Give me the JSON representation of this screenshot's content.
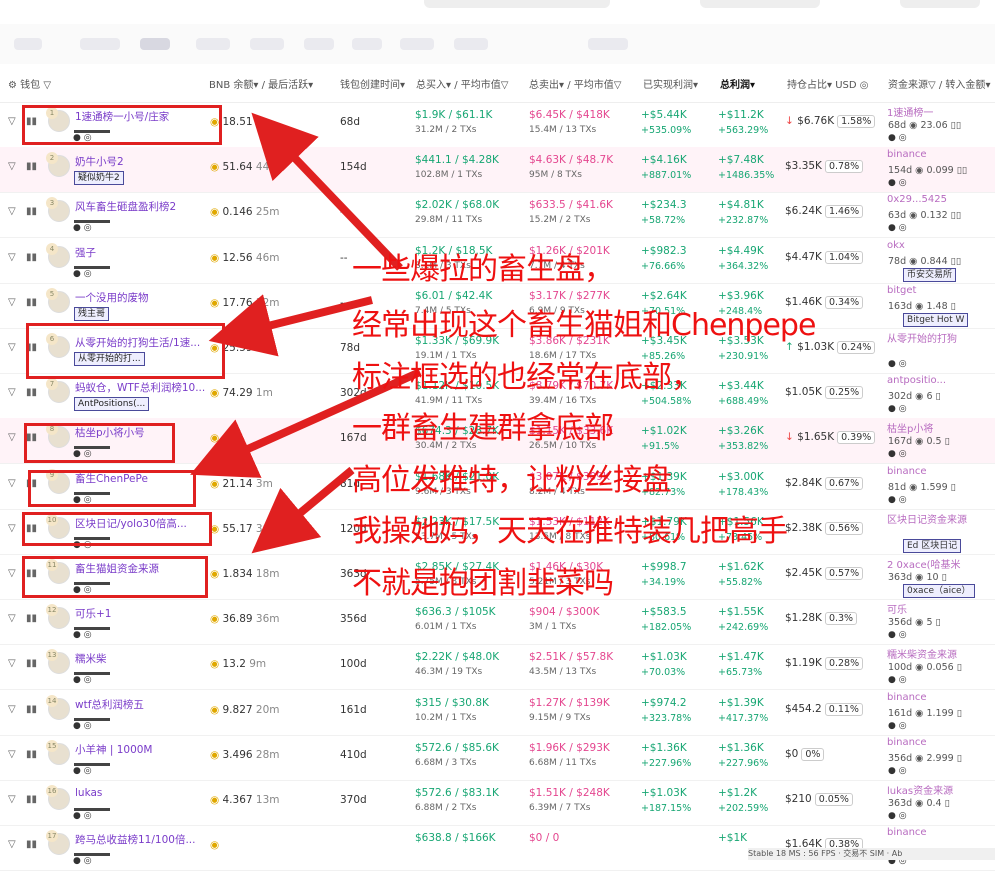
{
  "header": {
    "wallet": "钱包",
    "bnb_balance": "BNB 余额",
    "last_active": "/ 最后活跃",
    "created": "钱包创建时间",
    "total_buy": "总买入",
    "avg_buy": "/ 平均市值",
    "total_sell": "总卖出",
    "avg_sell": "/ 平均市值",
    "realized": "已实现利润",
    "total_profit": "总利润",
    "holding": "持仓占比",
    "usd": "USD",
    "fund_source": "资金来源",
    "transfer_in": "/ 转入金额"
  },
  "rows": [
    {
      "rank": "1",
      "name": "1速通榜一小号/庄家",
      "tag": "",
      "bnb": "18.51",
      "active": "7s",
      "age": "68d",
      "buy": "$1.9K / $61.1K",
      "buy_sub": "31.2M / 2 TXs",
      "sell": "$6.45K / $418K",
      "sell_sub": "15.4M / 13 TXs",
      "realized": "+$5.44K",
      "realized_pct": "+535.09%",
      "profit": "+$11.2K",
      "profit_pct": "+563.29%",
      "hold_arrow": "↓",
      "hold": "$6.76K",
      "hold_pct": "1.58%",
      "src": "1速通榜一",
      "src_sub": "68d ◉ 23.06 ▯▯",
      "src_box": "",
      "pink": false
    },
    {
      "rank": "2",
      "name": "奶牛小号2",
      "tag": "疑似奶牛2",
      "bnb": "51.64",
      "active": "44s",
      "age": "154d",
      "buy": "$441.1 / $4.28K",
      "buy_sub": "102.8M / 1 TXs",
      "sell": "$4.63K / $48.7K",
      "sell_sub": "95M / 8 TXs",
      "realized": "+$4.16K",
      "realized_pct": "+887.01%",
      "profit": "+$7.48K",
      "profit_pct": "+1486.35%",
      "hold_arrow": "",
      "hold": "$3.35K",
      "hold_pct": "0.78%",
      "src": "binance",
      "src_sub": "154d ◉ 0.099 ▯▯",
      "src_box": "",
      "pink": true
    },
    {
      "rank": "3",
      "name": "风车畜生砸盘盈利榜2",
      "tag": "",
      "bnb": "0.146",
      "active": "25m",
      "age": "--",
      "buy": "$2.02K / $68.0K",
      "buy_sub": "29.8M / 11 TXs",
      "sell": "$633.5 / $41.6K",
      "sell_sub": "15.2M / 2 TXs",
      "realized": "+$234.3",
      "realized_pct": "+58.72%",
      "profit": "+$4.81K",
      "profit_pct": "+232.87%",
      "hold_arrow": "",
      "hold": "$6.24K",
      "hold_pct": "1.46%",
      "src": "0x29...5425",
      "src_sub": "63d ◉ 0.132 ▯▯",
      "src_box": "",
      "pink": false
    },
    {
      "rank": "4",
      "name": "强子",
      "tag": "",
      "bnb": "12.56",
      "active": "46m",
      "age": "--",
      "buy": "$1.2K / $18.5K",
      "buy_sub": "8.1M / 3 TXs",
      "sell": "$1.26K / $201K",
      "sell_sub": "7.7M / 4 TXs",
      "realized": "+$982.3",
      "realized_pct": "+76.66%",
      "profit": "+$4.49K",
      "profit_pct": "+364.32%",
      "hold_arrow": "",
      "hold": "$4.47K",
      "hold_pct": "1.04%",
      "src": "okx",
      "src_sub": "78d ◉ 0.844 ▯▯",
      "src_box": "币安交易所",
      "pink": false
    },
    {
      "rank": "5",
      "name": "一个没用的废物",
      "tag": "残主哥",
      "bnb": "17.76",
      "active": "32m",
      "age": "--",
      "buy": "$6.01 / $42.4K",
      "buy_sub": "7.4M / 5 TXs",
      "sell": "$3.17K / $277K",
      "sell_sub": "6.9M / 9 TXs",
      "realized": "+$2.64K",
      "realized_pct": "+70.51%",
      "profit": "+$3.96K",
      "profit_pct": "+248.4%",
      "hold_arrow": "",
      "hold": "$1.46K",
      "hold_pct": "0.34%",
      "src": "bitget",
      "src_sub": "163d ◉ 1.48 ▯",
      "src_box": "Bitget Hot W",
      "pink": false
    },
    {
      "rank": "6",
      "name": "从零开始的打狗生活/1速...",
      "tag": "从零开始的打...",
      "bnb": "25.59",
      "active": "3m",
      "age": "78d",
      "buy": "$1.33K / $69.9K",
      "buy_sub": "19.1M / 1 TXs",
      "sell": "$3.86K / $231K",
      "sell_sub": "18.6M / 17 TXs",
      "realized": "+$3.45K",
      "realized_pct": "+85.26%",
      "profit": "+$3.53K",
      "profit_pct": "+230.91%",
      "hold_arrow": "↑",
      "hold": "$1.03K",
      "hold_pct": "0.24%",
      "src": "从零开始的打狗",
      "src_sub": "",
      "src_box": "",
      "pink": false
    },
    {
      "rank": "7",
      "name": "蚂蚁仓，WTF总利润榜10...",
      "tag": "AntPositions(...",
      "bnb": "74.29",
      "active": "1m",
      "age": "302d",
      "buy": "$1.12K / $10.5K",
      "buy_sub": "41.9M / 11 TXs",
      "sell": "$8.79K / $70.7K",
      "sell_sub": "39.4M / 16 TXs",
      "realized": "+$2.33K",
      "realized_pct": "+504.58%",
      "profit": "+$3.44K",
      "profit_pct": "+688.49%",
      "hold_arrow": "",
      "hold": "$1.05K",
      "hold_pct": "0.25%",
      "src": "antpositio...",
      "src_sub": "302d ◉ 6 ▯",
      "src_box": "",
      "pink": false
    },
    {
      "rank": "8",
      "name": "枯坐p小将小号",
      "tag": "",
      "bnb": "0.0",
      "active": "",
      "age": "167d",
      "buy": "$674.3 / $28.7K",
      "buy_sub": "30.4M / 2 TXs",
      "sell": "$1.15K / $33.6K",
      "sell_sub": "26.5M / 10 TXs",
      "realized": "+$1.02K",
      "realized_pct": "+91.5%",
      "profit": "+$3.26K",
      "profit_pct": "+353.82%",
      "hold_arrow": "↓",
      "hold": "$1.65K",
      "hold_pct": "0.39%",
      "src": "枯坐p小将",
      "src_sub": "167d ◉ 0.5 ▯",
      "src_box": "",
      "pink": true
    },
    {
      "rank": "9",
      "name": "畜生ChenPePe",
      "tag": "",
      "bnb": "21.14",
      "active": "3m",
      "age": "81d",
      "buy": "$1.68K / $21.0K",
      "buy_sub": "9.6M / 3 TXs",
      "sell": "$3.07K / $309K",
      "sell_sub": "8.2M / 4 TXs",
      "realized": "+$1.39K",
      "realized_pct": "+82.73%",
      "profit": "+$3.00K",
      "profit_pct": "+178.43%",
      "hold_arrow": "",
      "hold": "$2.84K",
      "hold_pct": "0.67%",
      "src": "binance",
      "src_sub": "81d ◉ 1.599 ▯",
      "src_box": "",
      "pink": false
    },
    {
      "rank": "10",
      "name": "区块日记/yolo30倍高...",
      "tag": "",
      "bnb": "55.17",
      "active": "30m",
      "age": "120d",
      "buy": "$2.23K / $17.5K",
      "buy_sub": "13.7M / 5 TXs",
      "sell": "$1.53K / $112K",
      "sell_sub": "13.5M / 8 TXs",
      "realized": "+$1.79K",
      "realized_pct": "+80.61%",
      "profit": "+$1.56K",
      "profit_pct": "+73.45%",
      "hold_arrow": "",
      "hold": "$2.38K",
      "hold_pct": "0.56%",
      "src": "区块日记资金来源",
      "src_sub": "",
      "src_box": "Ed 区块日记",
      "pink": false
    },
    {
      "rank": "11",
      "name": "畜生猫姐资金来源",
      "tag": "",
      "bnb": "1.834",
      "active": "18m",
      "age": "363d",
      "buy": "$2.85K / $27.4K",
      "buy_sub": "5.75M / 3 TXs",
      "sell": "$1.46K / $30K",
      "sell_sub": "5.21M / 3 TXs",
      "realized": "+$998.7",
      "realized_pct": "+34.19%",
      "profit": "+$1.62K",
      "profit_pct": "+55.82%",
      "hold_arrow": "",
      "hold": "$2.45K",
      "hold_pct": "0.57%",
      "src": "2 0xace(哈基米",
      "src_sub": "363d ◉ 10 ▯",
      "src_box": "0xace（aice）",
      "pink": false
    },
    {
      "rank": "12",
      "name": "可乐+1",
      "tag": "",
      "bnb": "36.89",
      "active": "36m",
      "age": "356d",
      "buy": "$636.3 / $105K",
      "buy_sub": "6.01M / 1 TXs",
      "sell": "$904 / $300K",
      "sell_sub": "3M / 1 TXs",
      "realized": "+$583.5",
      "realized_pct": "+182.05%",
      "profit": "+$1.55K",
      "profit_pct": "+242.69%",
      "hold_arrow": "",
      "hold": "$1.28K",
      "hold_pct": "0.3%",
      "src": "可乐",
      "src_sub": "356d ◉ 5 ▯",
      "src_box": "",
      "pink": false
    },
    {
      "rank": "13",
      "name": "糯米柴",
      "tag": "",
      "bnb": "13.2",
      "active": "9m",
      "age": "100d",
      "buy": "$2.22K / $48.0K",
      "buy_sub": "46.3M / 19 TXs",
      "sell": "$2.51K / $57.8K",
      "sell_sub": "43.5M / 13 TXs",
      "realized": "+$1.03K",
      "realized_pct": "+70.03%",
      "profit": "+$1.47K",
      "profit_pct": "+65.73%",
      "hold_arrow": "",
      "hold": "$1.19K",
      "hold_pct": "0.28%",
      "src": "糯米柴资金来源",
      "src_sub": "100d ◉ 0.056 ▯",
      "src_box": "",
      "pink": false
    },
    {
      "rank": "14",
      "name": "wtf总利润榜五",
      "tag": "",
      "bnb": "9.827",
      "active": "20m",
      "age": "161d",
      "buy": "$315 / $30.8K",
      "buy_sub": "10.2M / 1 TXs",
      "sell": "$1.27K / $139K",
      "sell_sub": "9.15M / 9 TXs",
      "realized": "+$974.2",
      "realized_pct": "+323.78%",
      "profit": "+$1.39K",
      "profit_pct": "+417.37%",
      "hold_arrow": "",
      "hold": "$454.2",
      "hold_pct": "0.11%",
      "src": "binance",
      "src_sub": "161d ◉ 1.199 ▯",
      "src_box": "",
      "pink": false
    },
    {
      "rank": "15",
      "name": "小羊神 | 1000M",
      "tag": "",
      "bnb": "3.496",
      "active": "28m",
      "age": "410d",
      "buy": "$572.6 / $85.6K",
      "buy_sub": "6.68M / 3 TXs",
      "sell": "$1.96K / $293K",
      "sell_sub": "6.68M / 11 TXs",
      "realized": "+$1.36K",
      "realized_pct": "+227.96%",
      "profit": "+$1.36K",
      "profit_pct": "+227.96%",
      "hold_arrow": "",
      "hold": "$0",
      "hold_pct": "0%",
      "src": "binance",
      "src_sub": "356d ◉ 2.999 ▯",
      "src_box": "",
      "pink": false
    },
    {
      "rank": "16",
      "name": "lukas",
      "tag": "",
      "bnb": "4.367",
      "active": "13m",
      "age": "370d",
      "buy": "$572.6 / $83.1K",
      "buy_sub": "6.88M / 2 TXs",
      "sell": "$1.51K / $248K",
      "sell_sub": "6.39M / 7 TXs",
      "realized": "+$1.03K",
      "realized_pct": "+187.15%",
      "profit": "+$1.2K",
      "profit_pct": "+202.59%",
      "hold_arrow": "",
      "hold": "$210",
      "hold_pct": "0.05%",
      "src": "lukas资金来源",
      "src_sub": "363d ◉ 0.4 ▯",
      "src_box": "",
      "pink": false
    },
    {
      "rank": "17",
      "name": "跨马总收益榜11/100倍...",
      "tag": "",
      "bnb": "",
      "active": "",
      "age": "",
      "buy": "$638.8 / $166K",
      "buy_sub": "",
      "sell": "$0 / 0",
      "sell_sub": "",
      "realized": "",
      "realized_pct": "",
      "profit": "+$1K",
      "profit_pct": "",
      "hold_arrow": "",
      "hold": "$1.64K",
      "hold_pct": "0.38%",
      "src": "binance",
      "src_sub": "",
      "src_box": "",
      "pink": false
    }
  ],
  "overlay_lines": [
    "一些爆拉的畜生盘，",
    "经常出现这个畜生猫姐和Chenpepe",
    "标注框选的也经常在底部，",
    "一群畜生建群拿底部",
    "高位发推特，让粉丝接盘",
    "我操她妈，天天在推特装几把高手",
    "不就是抱团割韭菜吗"
  ],
  "statusbar": {
    "text": "Stable 18 MS : 56 FPS  ·  交易不  SIM  ·  Ab"
  },
  "colors": {
    "green": "#17a673",
    "pink": "#e4468f",
    "overlay_red": "#e11111",
    "name_purple": "#7a3cc9"
  }
}
